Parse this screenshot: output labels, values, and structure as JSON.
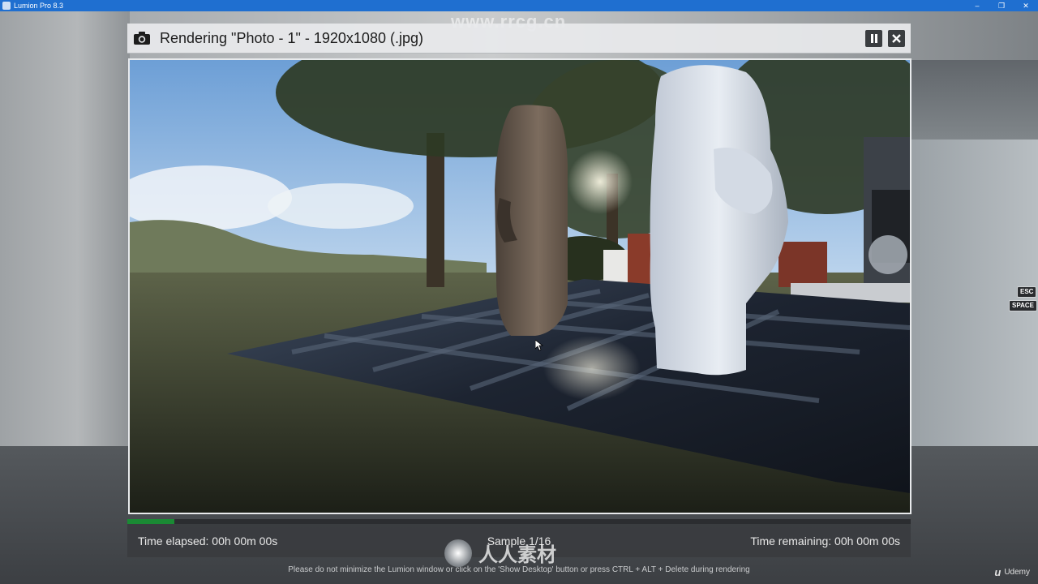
{
  "window": {
    "title": "Lumion Pro 8.3",
    "controls": [
      "minimize",
      "restore",
      "close"
    ]
  },
  "render_dialog": {
    "title": "Rendering \"Photo - 1\" - 1920x1080 (.jpg)",
    "header_icon": "camera-icon",
    "pause_icon": "pause-icon",
    "close_icon": "close-icon",
    "progress_fraction": 0.06,
    "progress_color": "#1a8a34",
    "status": {
      "elapsed": "Time elapsed: 00h 00m 00s",
      "sample": "Sample 1/16",
      "remaining": "Time remaining: 00h 00m 00s"
    },
    "notice": "Please do not minimize the Lumion window or click on the 'Show Desktop' button or press CTRL + ALT + Delete during rendering"
  },
  "key_hints": {
    "esc": "ESC",
    "space": "SPACE"
  },
  "branding": {
    "udemy_label": "Udemy",
    "watermark_url": "www.rrcg.cn",
    "watermark_logo_text": "人人素材"
  },
  "colors": {
    "titlebar": "#1f6fd0",
    "status_bar": "#3a3c3f"
  }
}
